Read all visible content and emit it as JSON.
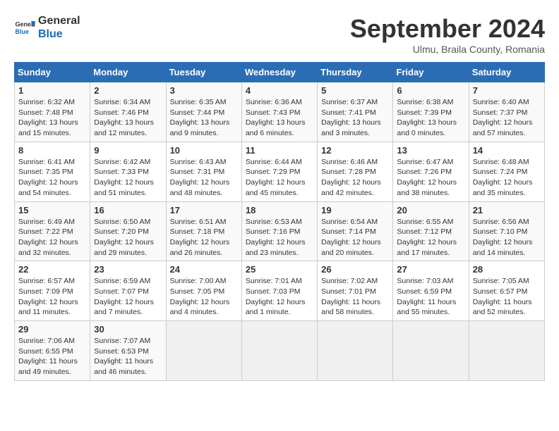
{
  "header": {
    "logo_general": "General",
    "logo_blue": "Blue",
    "month_title": "September 2024",
    "location": "Ulmu, Braila County, Romania"
  },
  "calendar": {
    "days_of_week": [
      "Sunday",
      "Monday",
      "Tuesday",
      "Wednesday",
      "Thursday",
      "Friday",
      "Saturday"
    ],
    "weeks": [
      [
        {
          "day": "1",
          "sunrise": "6:32 AM",
          "sunset": "7:48 PM",
          "daylight": "13 hours and 15 minutes."
        },
        {
          "day": "2",
          "sunrise": "6:34 AM",
          "sunset": "7:46 PM",
          "daylight": "13 hours and 12 minutes."
        },
        {
          "day": "3",
          "sunrise": "6:35 AM",
          "sunset": "7:44 PM",
          "daylight": "13 hours and 9 minutes."
        },
        {
          "day": "4",
          "sunrise": "6:36 AM",
          "sunset": "7:43 PM",
          "daylight": "13 hours and 6 minutes."
        },
        {
          "day": "5",
          "sunrise": "6:37 AM",
          "sunset": "7:41 PM",
          "daylight": "13 hours and 3 minutes."
        },
        {
          "day": "6",
          "sunrise": "6:38 AM",
          "sunset": "7:39 PM",
          "daylight": "13 hours and 0 minutes."
        },
        {
          "day": "7",
          "sunrise": "6:40 AM",
          "sunset": "7:37 PM",
          "daylight": "12 hours and 57 minutes."
        }
      ],
      [
        {
          "day": "8",
          "sunrise": "6:41 AM",
          "sunset": "7:35 PM",
          "daylight": "12 hours and 54 minutes."
        },
        {
          "day": "9",
          "sunrise": "6:42 AM",
          "sunset": "7:33 PM",
          "daylight": "12 hours and 51 minutes."
        },
        {
          "day": "10",
          "sunrise": "6:43 AM",
          "sunset": "7:31 PM",
          "daylight": "12 hours and 48 minutes."
        },
        {
          "day": "11",
          "sunrise": "6:44 AM",
          "sunset": "7:29 PM",
          "daylight": "12 hours and 45 minutes."
        },
        {
          "day": "12",
          "sunrise": "6:46 AM",
          "sunset": "7:28 PM",
          "daylight": "12 hours and 42 minutes."
        },
        {
          "day": "13",
          "sunrise": "6:47 AM",
          "sunset": "7:26 PM",
          "daylight": "12 hours and 38 minutes."
        },
        {
          "day": "14",
          "sunrise": "6:48 AM",
          "sunset": "7:24 PM",
          "daylight": "12 hours and 35 minutes."
        }
      ],
      [
        {
          "day": "15",
          "sunrise": "6:49 AM",
          "sunset": "7:22 PM",
          "daylight": "12 hours and 32 minutes."
        },
        {
          "day": "16",
          "sunrise": "6:50 AM",
          "sunset": "7:20 PM",
          "daylight": "12 hours and 29 minutes."
        },
        {
          "day": "17",
          "sunrise": "6:51 AM",
          "sunset": "7:18 PM",
          "daylight": "12 hours and 26 minutes."
        },
        {
          "day": "18",
          "sunrise": "6:53 AM",
          "sunset": "7:16 PM",
          "daylight": "12 hours and 23 minutes."
        },
        {
          "day": "19",
          "sunrise": "6:54 AM",
          "sunset": "7:14 PM",
          "daylight": "12 hours and 20 minutes."
        },
        {
          "day": "20",
          "sunrise": "6:55 AM",
          "sunset": "7:12 PM",
          "daylight": "12 hours and 17 minutes."
        },
        {
          "day": "21",
          "sunrise": "6:56 AM",
          "sunset": "7:10 PM",
          "daylight": "12 hours and 14 minutes."
        }
      ],
      [
        {
          "day": "22",
          "sunrise": "6:57 AM",
          "sunset": "7:09 PM",
          "daylight": "12 hours and 11 minutes."
        },
        {
          "day": "23",
          "sunrise": "6:59 AM",
          "sunset": "7:07 PM",
          "daylight": "12 hours and 7 minutes."
        },
        {
          "day": "24",
          "sunrise": "7:00 AM",
          "sunset": "7:05 PM",
          "daylight": "12 hours and 4 minutes."
        },
        {
          "day": "25",
          "sunrise": "7:01 AM",
          "sunset": "7:03 PM",
          "daylight": "12 hours and 1 minute."
        },
        {
          "day": "26",
          "sunrise": "7:02 AM",
          "sunset": "7:01 PM",
          "daylight": "11 hours and 58 minutes."
        },
        {
          "day": "27",
          "sunrise": "7:03 AM",
          "sunset": "6:59 PM",
          "daylight": "11 hours and 55 minutes."
        },
        {
          "day": "28",
          "sunrise": "7:05 AM",
          "sunset": "6:57 PM",
          "daylight": "11 hours and 52 minutes."
        }
      ],
      [
        {
          "day": "29",
          "sunrise": "7:06 AM",
          "sunset": "6:55 PM",
          "daylight": "11 hours and 49 minutes."
        },
        {
          "day": "30",
          "sunrise": "7:07 AM",
          "sunset": "6:53 PM",
          "daylight": "11 hours and 46 minutes."
        },
        null,
        null,
        null,
        null,
        null
      ]
    ]
  }
}
